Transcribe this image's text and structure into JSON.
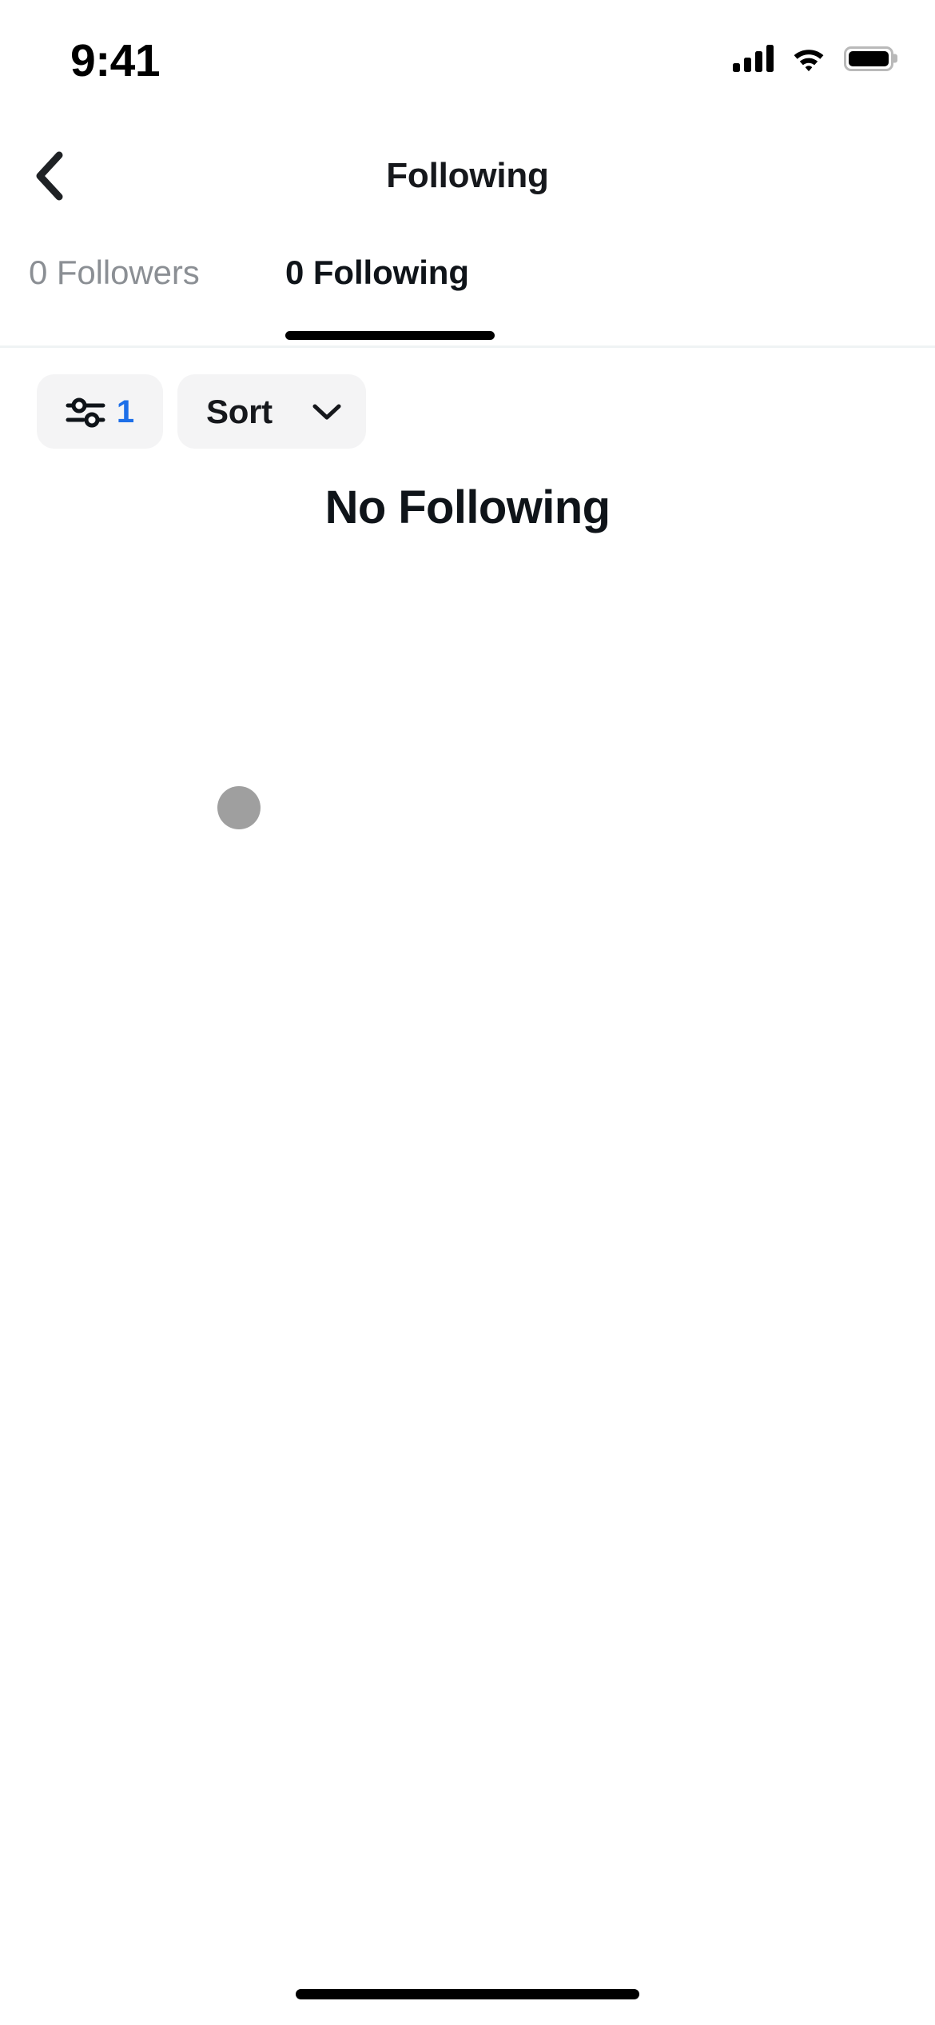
{
  "status_bar": {
    "time": "9:41",
    "cellular_icon": "cellular-signal-icon",
    "cellular_bars": 4,
    "wifi_icon": "wifi-icon",
    "battery_icon": "battery-icon",
    "battery_full": true
  },
  "nav": {
    "back_icon": "chevron-left-icon",
    "title": "Following"
  },
  "tabs": [
    {
      "label": "0 Followers",
      "active": false,
      "name": "tab-followers"
    },
    {
      "label": "0 Following",
      "active": true,
      "name": "tab-following"
    }
  ],
  "controls": {
    "filter": {
      "icon": "sliders-filter-icon",
      "count": "1",
      "count_color": "#1d6fe8"
    },
    "sort": {
      "label": "Sort",
      "chevron_icon": "chevron-down-icon"
    }
  },
  "empty_state": {
    "title": "No Following"
  },
  "home_indicator": "home-indicator",
  "touch_indicator": "touch-point-indicator",
  "colors": {
    "background": "#ffffff",
    "text_primary": "#0f1419",
    "text_muted": "#8b8f94",
    "pill_bg": "#f4f4f5",
    "accent_blue": "#1d6fe8",
    "divider": "#eff3f4",
    "indicator": "#000000"
  }
}
